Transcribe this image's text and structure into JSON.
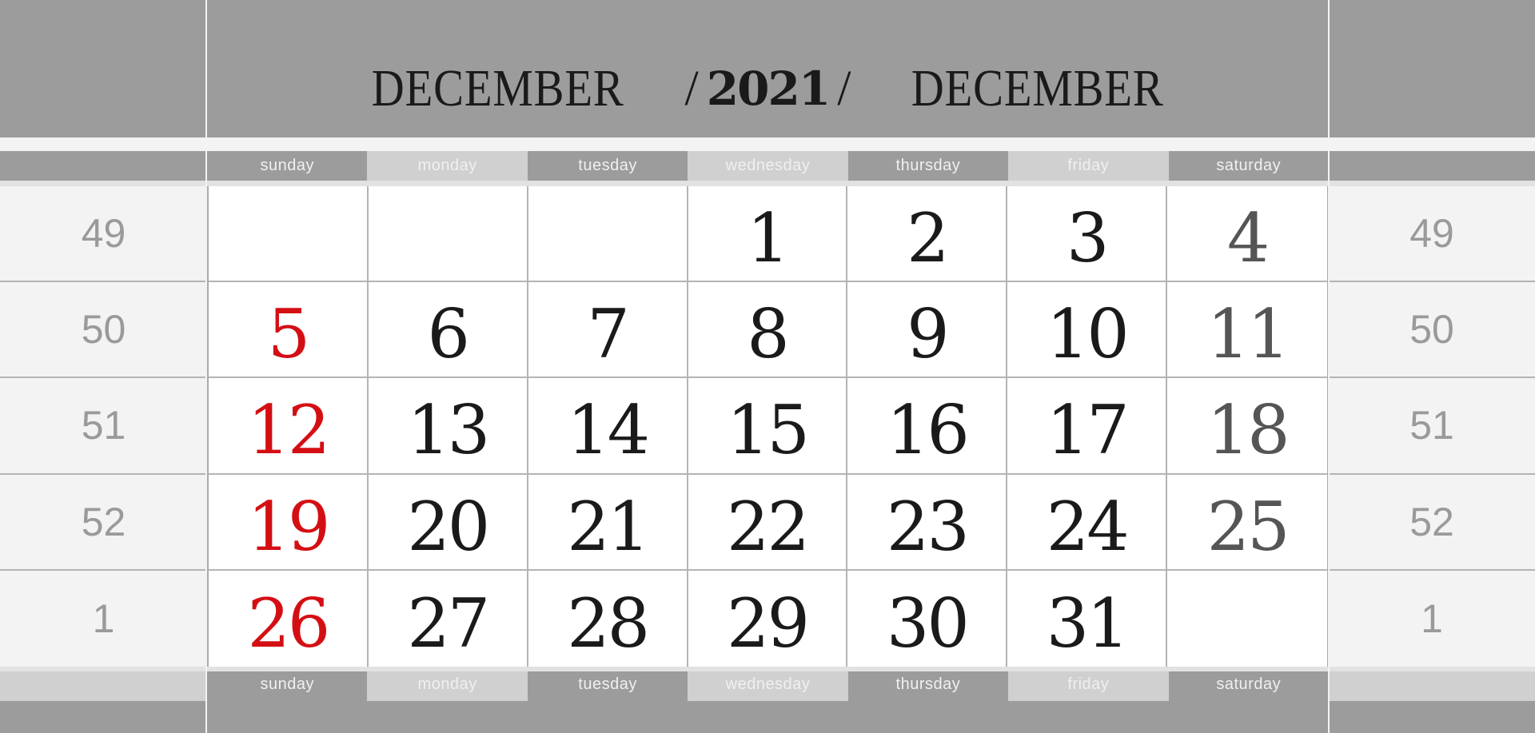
{
  "header": {
    "month_left": "DECEMBER",
    "slash": "/",
    "year": "2021",
    "month_right": "DECEMBER"
  },
  "weekdays": [
    "sunday",
    "monday",
    "tuesday",
    "wednesday",
    "thursday",
    "friday",
    "saturday"
  ],
  "week_numbers": [
    "49",
    "50",
    "51",
    "52",
    "1"
  ],
  "weeks": [
    [
      "",
      "",
      "",
      "1",
      "2",
      "3",
      "4"
    ],
    [
      "5",
      "6",
      "7",
      "8",
      "9",
      "10",
      "11"
    ],
    [
      "12",
      "13",
      "14",
      "15",
      "16",
      "17",
      "18"
    ],
    [
      "19",
      "20",
      "21",
      "22",
      "23",
      "24",
      "25"
    ],
    [
      "26",
      "27",
      "28",
      "29",
      "30",
      "31",
      ""
    ]
  ],
  "colors": {
    "sunday": "#d40f14",
    "weekday": "#1a1a1a",
    "saturday": "#555555",
    "band": "#9c9c9c",
    "band_light": "#cfd0cf"
  }
}
